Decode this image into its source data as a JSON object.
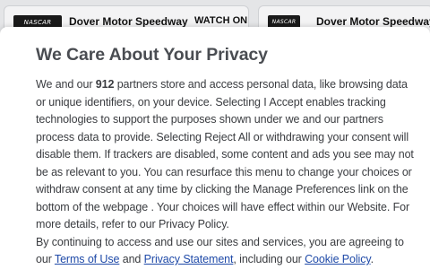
{
  "background": {
    "card1": {
      "logo": "NASCAR",
      "title": "Dover Motor Speedway",
      "watch": "WATCH ON"
    },
    "card2": {
      "logo": "NASCAR",
      "title": "Dover Motor Speedway"
    }
  },
  "dialog": {
    "title": "We Care About Your Privacy",
    "p1_a": "We and our ",
    "partner_count": "912",
    "p1_b": " partners store and access personal data, like browsing data or unique identifiers, on your device. Selecting I Accept enables tracking technologies to support the purposes shown under we and our partners process data to provide. Selecting Reject All or withdrawing your consent will disable them. If trackers are disabled, some content and ads you see may not be as relevant to you. You can resurface this menu to change your choices or withdraw consent at any time by clicking the Manage Preferences link on the bottom of the webpage . Your choices will have effect within our Website. For more details, refer to our Privacy Policy.",
    "p2_a": "By continuing to access and use our sites and services, you are agreeing to our ",
    "terms_link": "Terms of Use",
    "p2_b": " and ",
    "privacy_link": "Privacy Statement",
    "p2_c": ", including our ",
    "cookie_link": "Cookie Policy",
    "p2_d": "."
  }
}
